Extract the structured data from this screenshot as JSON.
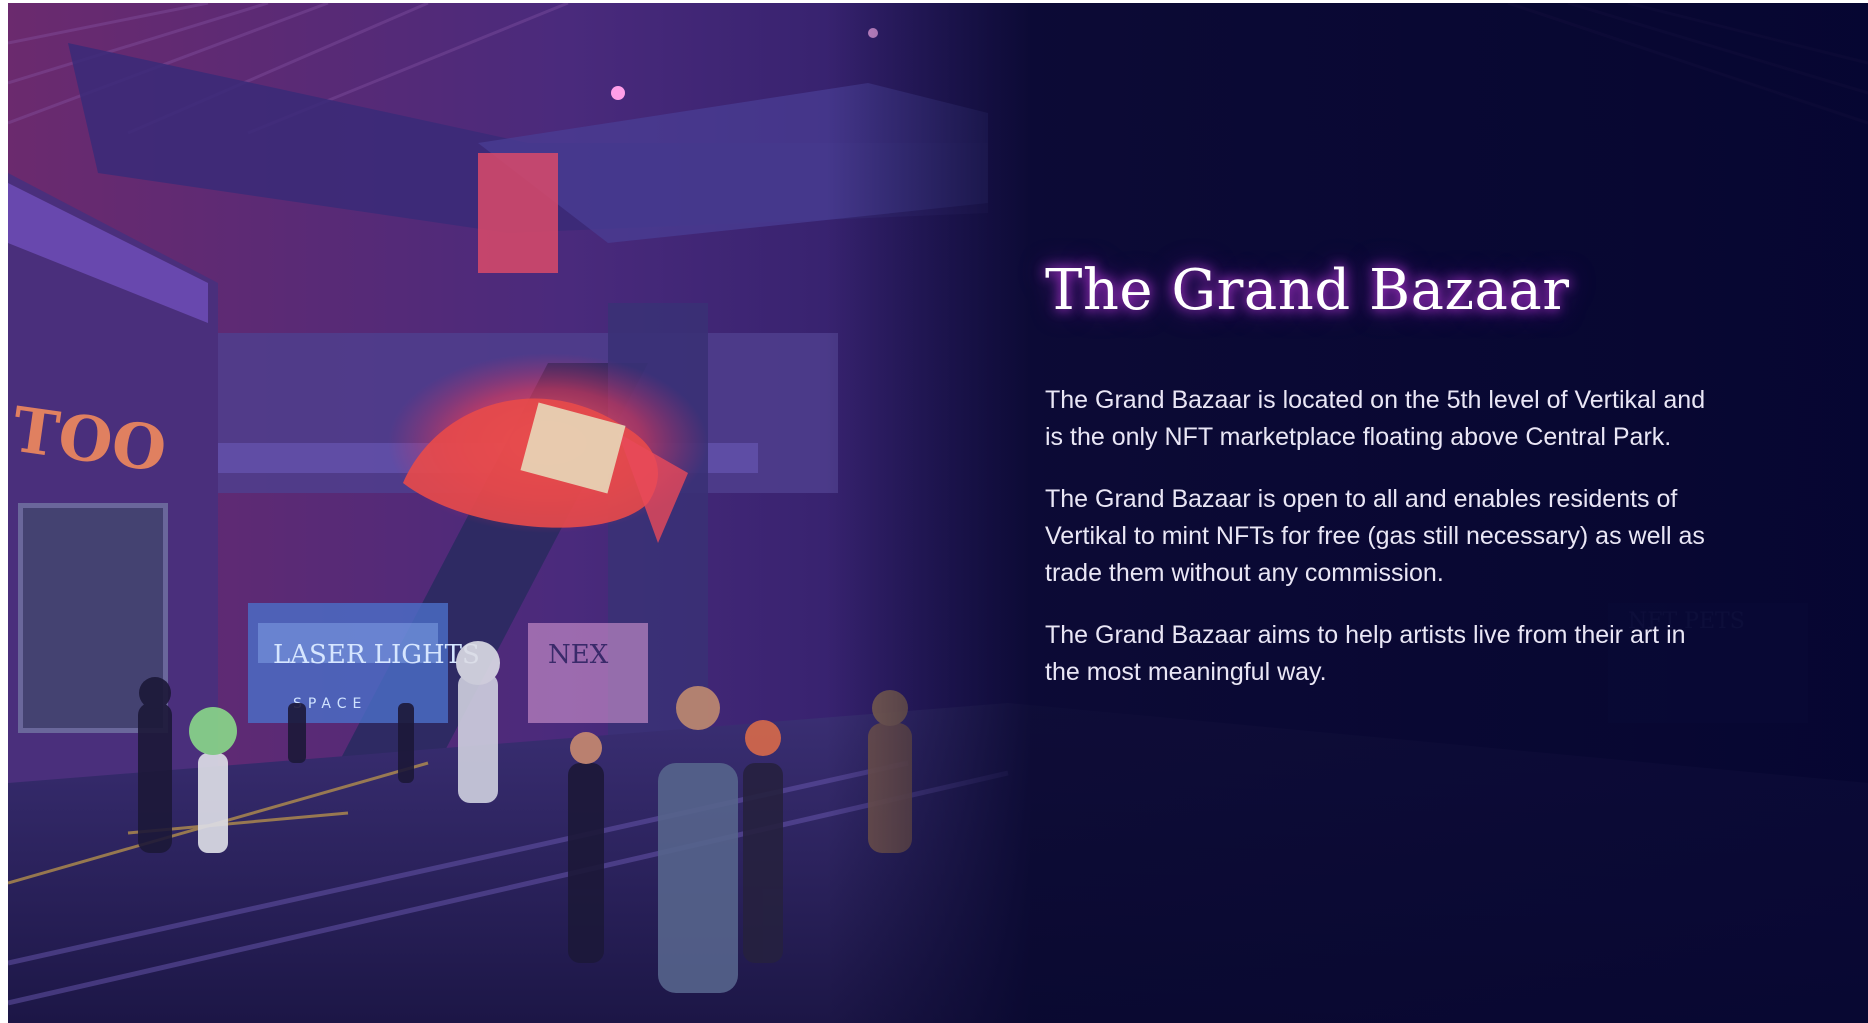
{
  "section": {
    "title": "The Grand Bazaar",
    "paragraphs": [
      "The Grand Bazaar is located on the 5th level of Vertikal and is the only NFT marketplace floating above Central Park.",
      "The Grand Bazaar is open to all and enables residents of Vertikal to mint NFTs for free (gas still necessary) as well as trade them without any commission.",
      "The Grand Bazaar aims to help artists live from their art in the most meaningful way."
    ]
  },
  "scene": {
    "signs": {
      "tattoo": "TOO",
      "laser": "LASER LIGHTS",
      "space": "SPACE",
      "next": "NEX",
      "pets": "NFT PETS"
    }
  },
  "colors": {
    "background_dark": "#07073a",
    "accent_glow": "#e246ff",
    "text": "#e9e6f5"
  }
}
